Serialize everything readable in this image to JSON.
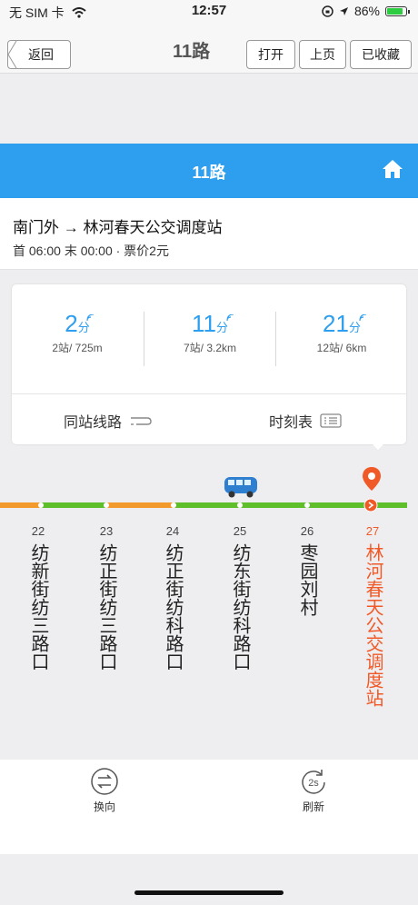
{
  "status_bar": {
    "carrier": "无 SIM 卡",
    "time": "12:57",
    "battery": "86%"
  },
  "nav": {
    "back_label": "返回",
    "title": "11路",
    "open_label": "打开",
    "prev_label": "上页",
    "fav_label": "已收藏"
  },
  "header": {
    "title": "11路"
  },
  "route": {
    "direction": "南门外 → 林河春天公交调度站",
    "schedule": "首 06:00 末 00:00 · 票价2元"
  },
  "arrivals": [
    {
      "minutes": "2",
      "unit": "分",
      "detail": "2站/ 725m"
    },
    {
      "minutes": "11",
      "unit": "分",
      "detail": "7站/ 3.2km"
    },
    {
      "minutes": "21",
      "unit": "分",
      "detail": "12站/ 6km"
    }
  ],
  "card_actions": {
    "same_stop": "同站线路",
    "timetable": "时刻表"
  },
  "stops": [
    {
      "index": "22",
      "name": "纺新街纺三路口"
    },
    {
      "index": "23",
      "name": "纺正街纺三路口"
    },
    {
      "index": "24",
      "name": "纺正街纺科路口"
    },
    {
      "index": "25",
      "name": "纺东街纺科路口"
    },
    {
      "index": "26",
      "name": "枣园刘村"
    },
    {
      "index": "27",
      "name": "林河春天公交调度站"
    }
  ],
  "bottom": {
    "reverse_label": "换向",
    "refresh_label": "刷新",
    "refresh_badge": "2s"
  },
  "colors": {
    "accent_blue": "#2e9fef",
    "line_green": "#5fbf2a",
    "line_orange": "#f39a2c",
    "current_stop": "#f05a28"
  }
}
